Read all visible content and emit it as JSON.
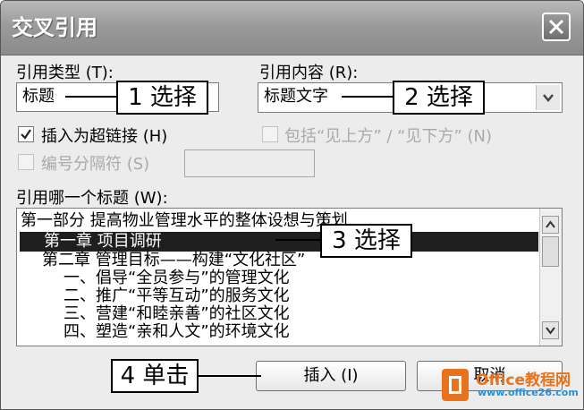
{
  "dialog": {
    "title": "交叉引用",
    "close_glyph": "×"
  },
  "reference_type": {
    "label": "引用类型 (T):",
    "value": "标题"
  },
  "reference_content": {
    "label": "引用内容 (R):",
    "value": "标题文字",
    "dropdown_icon": "chevron-down-icon"
  },
  "options": {
    "insert_hyperlink_label": "插入为超链接 (H)",
    "insert_hyperlink_checked": true,
    "include_above_below_label": "包括“见上方” / “见下方” (N)",
    "separator_label": "编号分隔符 (S)"
  },
  "heading_list": {
    "label": "引用哪一个标题 (W):",
    "items": [
      "第一部分    提高物业管理水平的整体设想与策划",
      "第一章  项目调研",
      "第二章  管理目标——构建“文化社区”",
      "一、倡导“全员参与”的管理文化",
      "二、推广“平等互动”的服务文化",
      "三、营建“和睦亲善”的社区文化",
      "四、塑造“亲和人文”的环境文化"
    ],
    "selected_index": 1
  },
  "buttons": {
    "insert": "插入 (I)",
    "cancel": "取消"
  },
  "callouts": {
    "c1": "1 选择",
    "c2": "2 选择",
    "c3": "3 选择",
    "c4": "4 单击"
  },
  "watermark": {
    "brand": "Office教程网",
    "url": "www.office26.com"
  },
  "colors": {
    "titlebar": "#9b9b9b",
    "selection": "#1f1f1f",
    "watermark_orange": "#e8731c",
    "watermark_blue": "#2a8fd6"
  }
}
